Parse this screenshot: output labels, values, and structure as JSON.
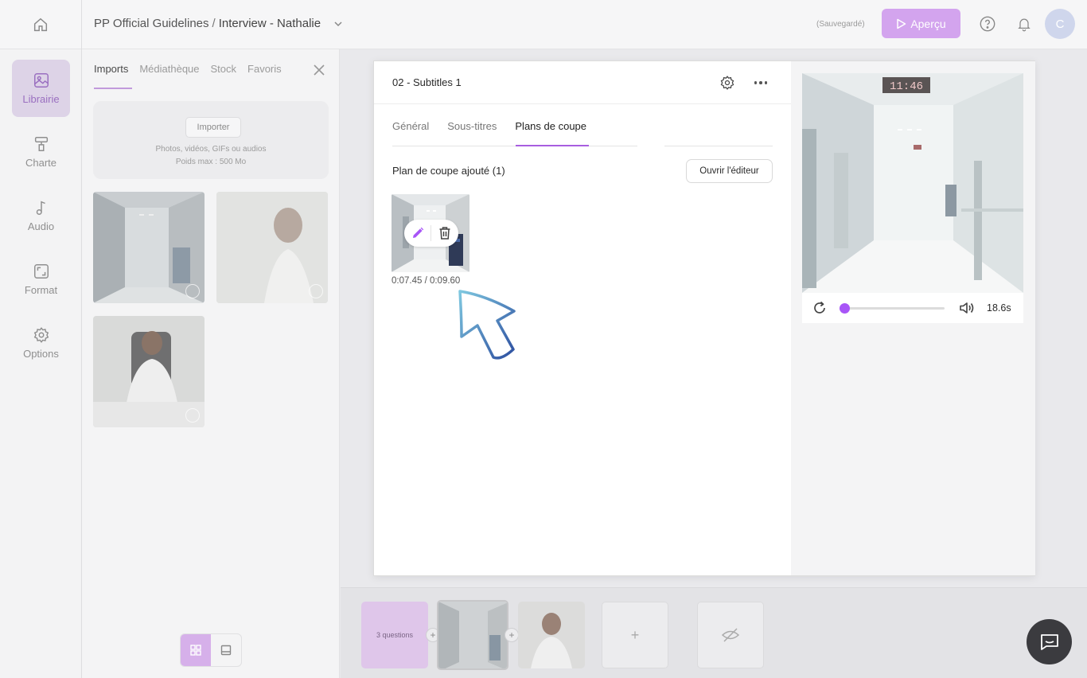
{
  "header": {
    "project": "PP Official Guidelines",
    "separator": "/",
    "page": "Interview - Nathalie",
    "saved_status": "(Sauvegardé)",
    "preview_label": "Aperçu",
    "avatar_initial": "C"
  },
  "rail": {
    "items": [
      {
        "label": "Librairie",
        "icon": "image-icon",
        "active": true
      },
      {
        "label": "Charte",
        "icon": "paint-roller-icon",
        "active": false
      },
      {
        "label": "Audio",
        "icon": "music-note-icon",
        "active": false
      },
      {
        "label": "Format",
        "icon": "aspect-ratio-icon",
        "active": false
      },
      {
        "label": "Options",
        "icon": "gear-icon",
        "active": false
      }
    ]
  },
  "library": {
    "tabs": [
      "Imports",
      "Médiathèque",
      "Stock",
      "Favoris"
    ],
    "active_tab": "Imports",
    "import_button": "Importer",
    "upload_hint_1": "Photos, vidéos, GIFs ou audios",
    "upload_hint_2": "Poids max : 500 Mo"
  },
  "timeline": {
    "questions_label": "3 questions"
  },
  "modal": {
    "title": "02 - Subtitles 1",
    "tabs": [
      "Général",
      "Sous-titres",
      "Plans de coupe"
    ],
    "active_tab": "Plans de coupe",
    "section_title": "Plan de coupe ajouté (1)",
    "open_editor": "Ouvrir l'éditeur",
    "cut_time": "0:07.45 / 0:09.60",
    "preview": {
      "clock": "11:46",
      "duration": "18.6s",
      "progress": 0.05
    }
  },
  "colors": {
    "accent": "#a855f7",
    "accent_soft": "#d3a4ee"
  }
}
